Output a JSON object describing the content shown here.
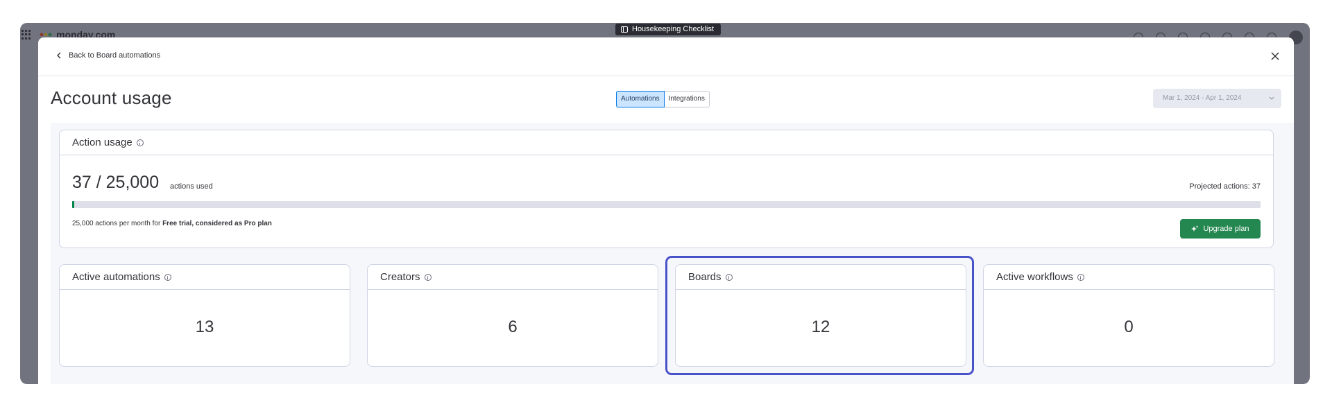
{
  "app": {
    "brand_name": "monday.com",
    "board_name": "Housekeeping Checklist"
  },
  "modal": {
    "back_label": "Back to Board automations",
    "title": "Account usage",
    "tabs": [
      {
        "label": "Automations",
        "active": true
      },
      {
        "label": "Integrations",
        "active": false
      }
    ],
    "date_range": "Mar 1, 2024 - Apr 1, 2024"
  },
  "action_usage": {
    "title": "Action usage",
    "used": 37,
    "limit": 25000,
    "count_text": "37 / 25,000",
    "count_suffix": "actions used",
    "projected_text": "Projected actions: 37",
    "progress_fraction": 0.00148,
    "plan_prefix": "25,000 actions per month for ",
    "plan_name": "Free trial, considered as Pro plan",
    "upgrade_label": "Upgrade plan"
  },
  "stats": [
    {
      "title": "Active automations",
      "value": "13"
    },
    {
      "title": "Creators",
      "value": "6"
    },
    {
      "title": "Boards",
      "value": "12",
      "highlighted": true
    },
    {
      "title": "Active workflows",
      "value": "0"
    }
  ],
  "colors": {
    "accent_blue": "#0073ea",
    "success_green": "#258750",
    "highlight": "#4a52c9",
    "overlay": "#71737f"
  },
  "icons": {
    "back": "chevron-left-icon",
    "close": "close-icon",
    "info": "info-icon",
    "dropdown": "chevron-down-icon",
    "upgrade": "sparkle-icon"
  }
}
